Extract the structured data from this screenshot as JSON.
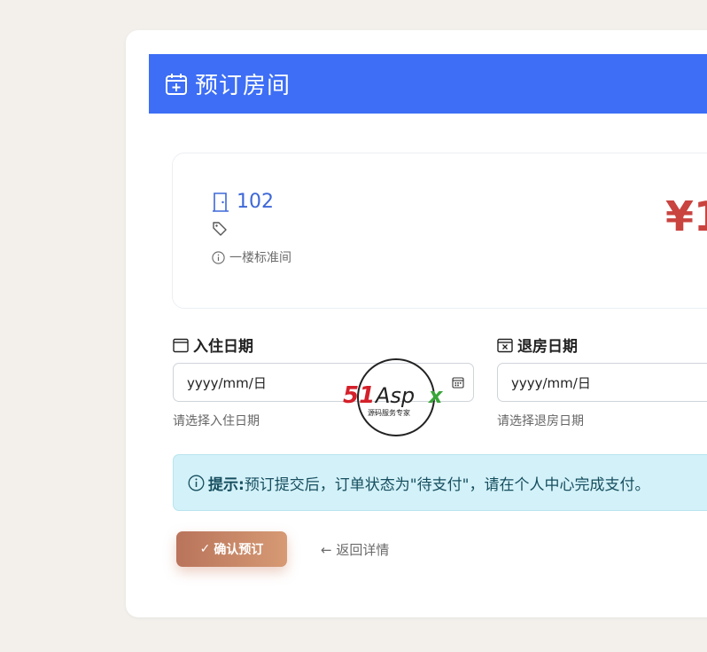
{
  "header": {
    "icon": "calendar-plus-icon",
    "title": "预订房间"
  },
  "room": {
    "number": "102",
    "description": "一楼标准间",
    "price": "¥1"
  },
  "checkin": {
    "label": "入住日期",
    "placeholder": "yyyy/mm/日",
    "help": "请选择入住日期"
  },
  "checkout": {
    "label": "退房日期",
    "placeholder": "yyyy/mm/日",
    "help": "请选择退房日期"
  },
  "tip": {
    "strong": "提示:",
    "text": "预订提交后，订单状态为\"待支付\"，请在个人中心完成支付。"
  },
  "actions": {
    "confirm_label": "确认预订",
    "back_label": "← 返回详情"
  },
  "watermark": {
    "brand": "51Aspx",
    "slogan": "源码服务专家"
  },
  "colors": {
    "header_bg": "#3d6ef5",
    "price": "#c9433f",
    "tip_bg": "#d3f1f8",
    "button_start": "#b9745b",
    "button_end": "#d69a74"
  }
}
